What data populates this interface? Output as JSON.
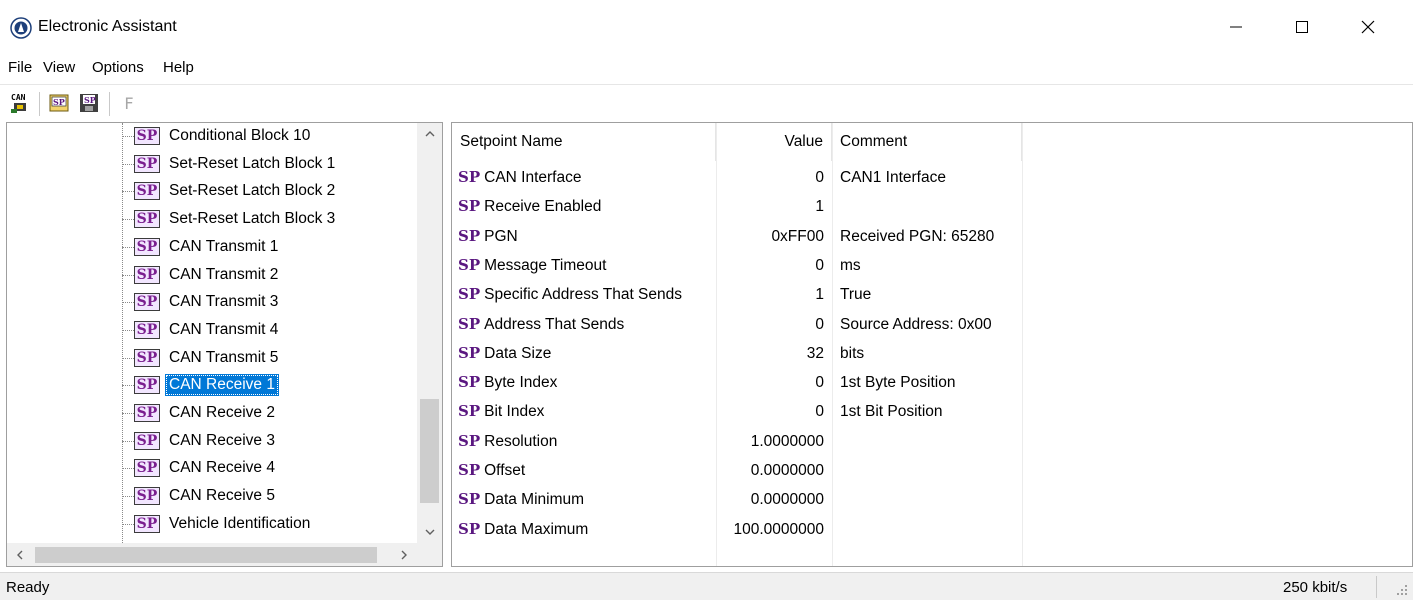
{
  "window": {
    "title": "Electronic Assistant"
  },
  "menu": {
    "items": [
      "File",
      "View",
      "Options",
      "Help"
    ]
  },
  "toolbar": {
    "buttons": [
      {
        "icon": "can-connect-icon",
        "label": "CAN"
      },
      {
        "icon": "open-setpoint-file-icon",
        "label": "SP"
      },
      {
        "icon": "save-setpoint-file-icon",
        "label": "SP"
      },
      {
        "icon": "flash-icon",
        "label": "F"
      }
    ]
  },
  "tree": {
    "items": [
      {
        "tag": "SP",
        "label": "Conditional Block 10",
        "selected": false
      },
      {
        "tag": "SP",
        "label": "Set-Reset Latch Block 1",
        "selected": false
      },
      {
        "tag": "SP",
        "label": "Set-Reset Latch Block 2",
        "selected": false
      },
      {
        "tag": "SP",
        "label": "Set-Reset Latch Block 3",
        "selected": false
      },
      {
        "tag": "SP",
        "label": "CAN Transmit 1",
        "selected": false
      },
      {
        "tag": "SP",
        "label": "CAN Transmit 2",
        "selected": false
      },
      {
        "tag": "SP",
        "label": "CAN Transmit 3",
        "selected": false
      },
      {
        "tag": "SP",
        "label": "CAN Transmit 4",
        "selected": false
      },
      {
        "tag": "SP",
        "label": "CAN Transmit 5",
        "selected": false
      },
      {
        "tag": "SP",
        "label": "CAN Receive 1",
        "selected": true
      },
      {
        "tag": "SP",
        "label": "CAN Receive 2",
        "selected": false
      },
      {
        "tag": "SP",
        "label": "CAN Receive 3",
        "selected": false
      },
      {
        "tag": "SP",
        "label": "CAN Receive 4",
        "selected": false
      },
      {
        "tag": "SP",
        "label": "CAN Receive 5",
        "selected": false
      },
      {
        "tag": "SP",
        "label": "Vehicle Identification",
        "selected": false
      }
    ],
    "vertical_scroll_position": 0.72
  },
  "setpoints": {
    "columns": [
      "Setpoint Name",
      "Value",
      "Comment"
    ],
    "rows": [
      {
        "tag": "SP",
        "name": "CAN Interface",
        "value": "0",
        "comment": "CAN1 Interface"
      },
      {
        "tag": "SP",
        "name": "Receive Enabled",
        "value": "1",
        "comment": ""
      },
      {
        "tag": "SP",
        "name": "PGN",
        "value": "0xFF00",
        "comment": "Received PGN: 65280"
      },
      {
        "tag": "SP",
        "name": "Message Timeout",
        "value": "0",
        "comment": "ms"
      },
      {
        "tag": "SP",
        "name": "Specific Address That Sends",
        "value": "1",
        "comment": "True"
      },
      {
        "tag": "SP",
        "name": "Address That Sends",
        "value": "0",
        "comment": "Source Address: 0x00"
      },
      {
        "tag": "SP",
        "name": "Data Size",
        "value": "32",
        "comment": "bits"
      },
      {
        "tag": "SP",
        "name": "Byte Index",
        "value": "0",
        "comment": "1st Byte Position"
      },
      {
        "tag": "SP",
        "name": "Bit Index",
        "value": "0",
        "comment": "1st Bit Position"
      },
      {
        "tag": "SP",
        "name": "Resolution",
        "value": "1.0000000",
        "comment": ""
      },
      {
        "tag": "SP",
        "name": "Offset",
        "value": "0.0000000",
        "comment": ""
      },
      {
        "tag": "SP",
        "name": "Data Minimum",
        "value": "0.0000000",
        "comment": ""
      },
      {
        "tag": "SP",
        "name": "Data Maximum",
        "value": "100.0000000",
        "comment": ""
      }
    ]
  },
  "status": {
    "left": "Ready",
    "right": "250 kbit/s"
  },
  "colors": {
    "selection": "#0078d7",
    "sp_tag": "#5a1780"
  }
}
